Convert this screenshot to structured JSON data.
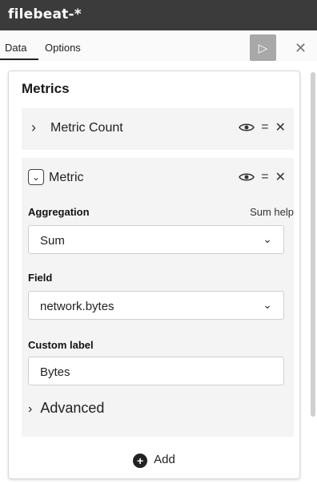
{
  "window": {
    "title": "filebeat-*"
  },
  "tabs": [
    {
      "label": "Data"
    },
    {
      "label": "Options"
    }
  ],
  "toolbar": {
    "run_icon": "play-icon",
    "close_icon": "close-icon"
  },
  "panel": {
    "title": "Metrics",
    "metric_count": {
      "label": "Metric Count"
    },
    "metric": {
      "label": "Metric",
      "aggregation_label": "Aggregation",
      "aggregation_help": "Sum help",
      "aggregation_value": "Sum",
      "field_label": "Field",
      "field_value": "network.bytes",
      "custom_label_label": "Custom label",
      "custom_label_value": "Bytes",
      "advanced_label": "Advanced"
    },
    "add_label": "Add"
  },
  "colors": {
    "titlebar_bg": "#3b3b3b",
    "run_button_bg": "#a8a8a8",
    "panel_bg": "#ffffff",
    "accordion_bg": "#f4f4f4"
  }
}
